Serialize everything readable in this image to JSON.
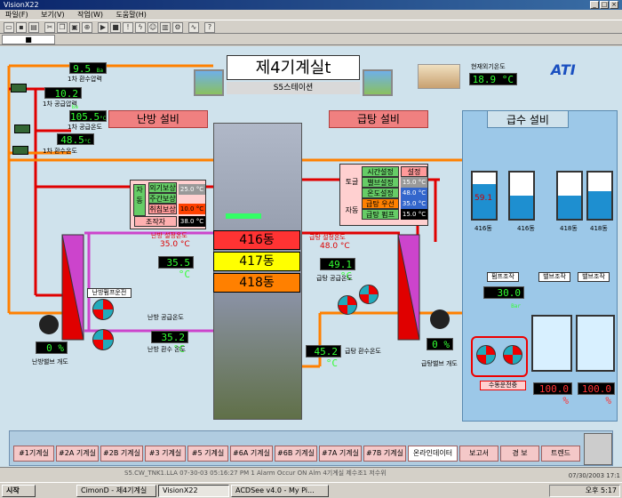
{
  "window": {
    "title": "VisionX22"
  },
  "menu": [
    "파일(F)",
    "보기(V)",
    "작업(W)",
    "도움말(H)"
  ],
  "tab": {
    "label": "■"
  },
  "header": {
    "title": "제4기계실t",
    "subtitle": "S5스테이션",
    "logo": "ATI"
  },
  "outdoor": {
    "label": "현재외기온도",
    "value": "18.9 °C"
  },
  "sections": {
    "heating": "난방 설비",
    "hotwater": "급탕 설비",
    "supply": "급수 설비"
  },
  "left_meters": [
    {
      "value": "9.5",
      "unit": "Ba",
      "label": "1차 환수압력"
    },
    {
      "value": "10.2",
      "unit": "Ba",
      "label": "1차 공급압력"
    },
    {
      "value": "105.5",
      "unit": "°C",
      "label": "1차 공급온도"
    },
    {
      "value": "48.5",
      "unit": "°C",
      "label": "1차 환수온도"
    }
  ],
  "heat_ctrl": {
    "auto": "자동",
    "outdoor_comp": "외기보상",
    "daynight_comp": "주간보상",
    "sleep_comp": "취침보상",
    "operator": "조작자",
    "val1": "25.0 °C",
    "val2": "10.0 °C",
    "val3": "38.0 °C"
  },
  "heat_set": {
    "label": "난방 설정온도",
    "value": "35.0 °C"
  },
  "heat_supply_temp": {
    "value": "35.5 °C"
  },
  "heat_pump_label": "난방펌프운전",
  "heat_supply": {
    "label": "난방 공급온도",
    "value": "35.2 °C"
  },
  "heat_return_label": "난방 환수 온도",
  "heat_valve": {
    "value": "0 %",
    "label": "난방밸브 개도"
  },
  "buildings": [
    "416동",
    "417동",
    "418동"
  ],
  "hw_set": {
    "label": "급탕 설정온도",
    "value": "48.0 °C"
  },
  "hw_ctrl": {
    "set_hdr": "설정",
    "time_set": "시간설정",
    "valve_set": "밸브설정",
    "temp_set": "온도설정",
    "hw_priority": "급탕 우선",
    "hw_pump": "급탕 펌프",
    "toggle": "토글",
    "auto": "자동",
    "v1": "15.0 °C",
    "v2": "48.0 °C",
    "v3": "35.0 °C",
    "v4": "15.0 °C"
  },
  "hw_supply": {
    "value": "49.1 °C",
    "label": "급탕 공급온도"
  },
  "hw_return": {
    "value": "45.2 °C",
    "label": "급탕 환수온도"
  },
  "hw_valve_label": "급탕밸브 개도",
  "tanks": [
    {
      "name": "416동",
      "value": "59.1",
      "fill": 0.75
    },
    {
      "name": "416동",
      "value": "",
      "fill": 0.5
    },
    {
      "name": "418동",
      "value": "",
      "fill": 0.5
    },
    {
      "name": "418동",
      "value": "",
      "fill": 0.6
    }
  ],
  "pressure": {
    "label": "펌프조작",
    "value": "30.0",
    "unit": "Bar"
  },
  "valve_ops": [
    "밸브조작",
    "밸브조작"
  ],
  "manual_op": "수동운전중",
  "tank_levels": [
    "100.0 %",
    "100.0 %"
  ],
  "nav": [
    "#1기계실",
    "#2A 기계실",
    "#2B 기계실",
    "#3 기계실",
    "#5 기계실",
    "#6A 기계실",
    "#6B 기계실",
    "#7A 기계실",
    "#7B 기계실",
    "온라인데이터",
    "보고서",
    "경 보",
    "트렌드"
  ],
  "statusbar": "S5.CW_TNK1.LLA     07-30-03 05:16:27 PM    1    Alarm Occur    ON Alm    4기계실 제수조1 저수위",
  "taskbar": {
    "start": "시작",
    "items": [
      "CimonD - 제4기계실",
      "VisionX22",
      "ACDSee v4.0 - My Pi..."
    ],
    "clock": "오후 5:17",
    "date": "07/30/2003 17:1"
  },
  "colors": {
    "panel": "#cfe2ec",
    "pipe_red": "#e00000",
    "pipe_orange": "#ff8000",
    "pipe_purple": "#cc44cc"
  }
}
